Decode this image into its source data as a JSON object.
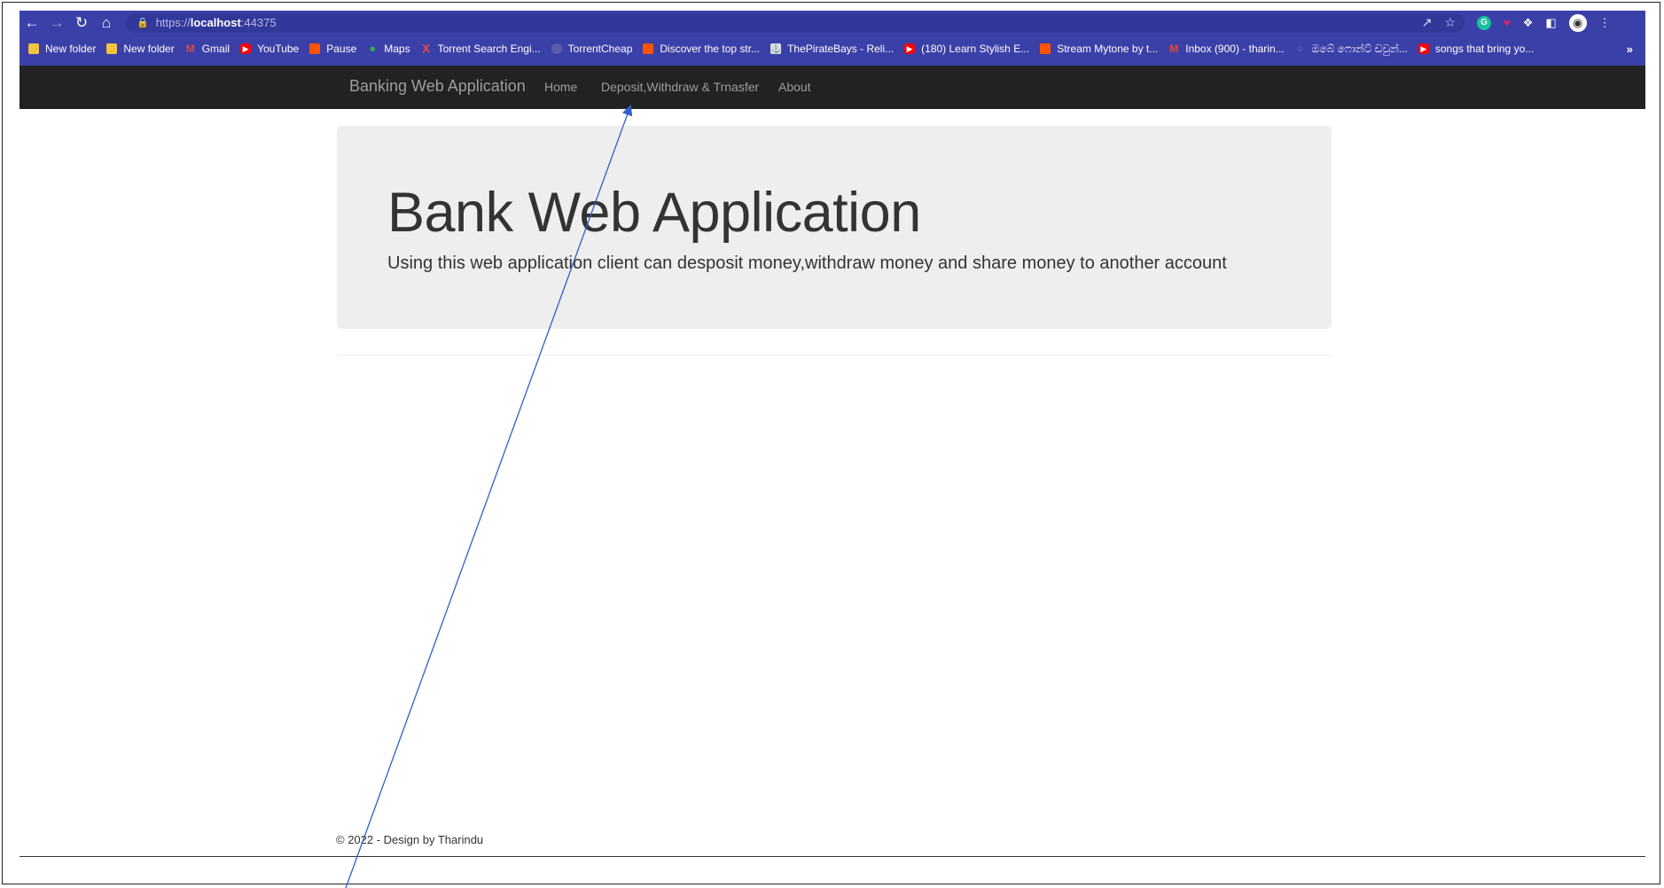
{
  "browser": {
    "url": {
      "scheme": "https://",
      "host": "localhost",
      "port": ":44375"
    },
    "nav_icons": [
      "back-arrow-icon",
      "forward-arrow-icon",
      "reload-icon",
      "home-icon"
    ],
    "bookmarks": [
      {
        "label": "New folder",
        "icon": "folder-icon"
      },
      {
        "label": "New folder",
        "icon": "folder-icon"
      },
      {
        "label": "Gmail",
        "icon": "gmail-icon"
      },
      {
        "label": "YouTube",
        "icon": "youtube-icon"
      },
      {
        "label": "Pause",
        "icon": "soundcloud-icon"
      },
      {
        "label": "Maps",
        "icon": "maps-icon"
      },
      {
        "label": "Torrent Search Engi...",
        "icon": "x-icon"
      },
      {
        "label": "TorrentCheap",
        "icon": "globe-icon"
      },
      {
        "label": "Discover the top str...",
        "icon": "soundcloud-icon"
      },
      {
        "label": "ThePirateBays - Reli...",
        "icon": "pirate-icon"
      },
      {
        "label": "(180) Learn Stylish E...",
        "icon": "youtube-icon"
      },
      {
        "label": "Stream Mytone by t...",
        "icon": "soundcloud-icon"
      },
      {
        "label": "Inbox (900) - tharin...",
        "icon": "gmail-icon"
      },
      {
        "label": "ඔබේ ෆොන්ට් ඩවුන්...",
        "icon": "lion-icon"
      },
      {
        "label": "songs that bring yo...",
        "icon": "youtube-icon"
      }
    ],
    "more_label": "»"
  },
  "navbar": {
    "brand": "Banking Web Application",
    "links": [
      "Home",
      "Deposit,Withdraw & Trnasfer",
      "About"
    ]
  },
  "jumbotron": {
    "title": "Bank Web Application",
    "lead": "Using this web application client can desposit money,withdraw money and share money to another account"
  },
  "footer": {
    "text": "© 2022 - Design by Tharindu"
  },
  "colors": {
    "browser_bar": "#3b40a8",
    "navbar_bg": "#222222",
    "nav_link": "#9d9d9d",
    "jumbotron_bg": "#eeeeee",
    "annotation_arrow": "#2f5fc8"
  }
}
